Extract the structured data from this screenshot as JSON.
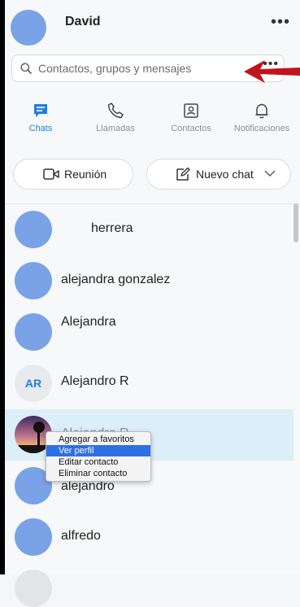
{
  "user": {
    "name": "David"
  },
  "search": {
    "placeholder": "Contactos, grupos y mensajes"
  },
  "tabs": [
    {
      "label": "Chats",
      "icon": "chat-icon",
      "active": true
    },
    {
      "label": "Llamadas",
      "icon": "phone-icon",
      "active": false
    },
    {
      "label": "Contactos",
      "icon": "contacts-icon",
      "active": false
    },
    {
      "label": "Notificaciones",
      "icon": "bell-icon",
      "active": false
    }
  ],
  "actions": {
    "meeting_label": "Reunión",
    "new_chat_label": "Nuevo chat"
  },
  "contacts": [
    {
      "name": "herrera"
    },
    {
      "name": "alejandra gonzalez"
    },
    {
      "name": "Alejandra"
    },
    {
      "name": "Alejandro R",
      "initials": "AR"
    },
    {
      "name": "Alejandro R"
    },
    {
      "name": "alejandro"
    },
    {
      "name": "alfredo"
    }
  ],
  "context_menu": {
    "items": [
      "Agregar a favoritos",
      "Ver perfil",
      "Editar contacto",
      "Eliminar contacto"
    ],
    "highlighted": "Ver perfil"
  },
  "colors": {
    "accent": "#1f7fe0",
    "avatar": "#7aa2e6",
    "selected_row": "#dceef7",
    "arrow": "#c0141c",
    "menu_highlight": "#2f6fe4"
  }
}
